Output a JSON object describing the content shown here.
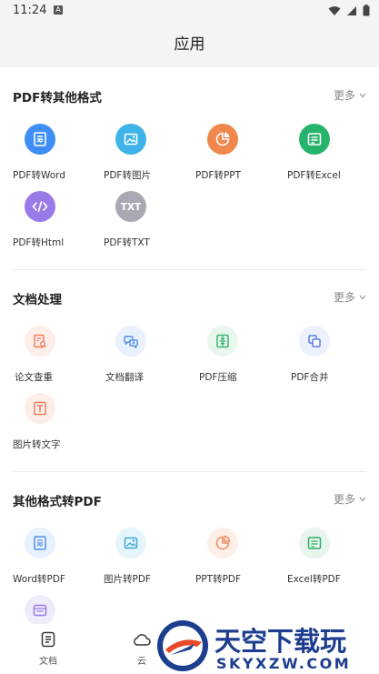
{
  "status": {
    "time": "11:24",
    "badge": "A"
  },
  "header": {
    "title": "应用"
  },
  "sections": [
    {
      "title": "PDF转其他格式",
      "more": "更多",
      "items": [
        {
          "label": "PDF转Word",
          "icon": "document-icon",
          "color": "#3f8ef6"
        },
        {
          "label": "PDF转图片",
          "icon": "image-icon",
          "color": "#3fb2e9"
        },
        {
          "label": "PDF转PPT",
          "icon": "pie-chart-icon",
          "color": "#f0874d"
        },
        {
          "label": "PDF转Excel",
          "icon": "spreadsheet-icon",
          "color": "#26b36c"
        },
        {
          "label": "PDF转Html",
          "icon": "code-icon",
          "color": "#9a7ae8"
        },
        {
          "label": "PDF转TXT",
          "icon": "txt-icon",
          "color": "#a9a9b3"
        }
      ]
    },
    {
      "title": "文档处理",
      "more": "更多",
      "items": [
        {
          "label": "论文查重",
          "icon": "doc-search-icon",
          "color": "#ef8060"
        },
        {
          "label": "文档翻译",
          "icon": "translate-icon",
          "color": "#4f8fe8"
        },
        {
          "label": "PDF压缩",
          "icon": "compress-icon",
          "color": "#36b56f"
        },
        {
          "label": "PDF合并",
          "icon": "merge-icon",
          "color": "#5a7fe0"
        },
        {
          "label": "图片转文字",
          "icon": "ocr-icon",
          "color": "#ef8060"
        }
      ]
    },
    {
      "title": "其他格式转PDF",
      "more": "更多",
      "items": [
        {
          "label": "Word转PDF",
          "icon": "document-icon",
          "color": "#4f8fe8"
        },
        {
          "label": "图片转PDF",
          "icon": "image-icon",
          "color": "#3fa9d9"
        },
        {
          "label": "PPT转PDF",
          "icon": "pie-chart-icon",
          "color": "#ef8a5a"
        },
        {
          "label": "Excel转PDF",
          "icon": "spreadsheet-icon",
          "color": "#2eae6a"
        },
        {
          "label": "",
          "icon": "browser-icon",
          "color": "#9a7ae8"
        }
      ]
    }
  ],
  "tabs": [
    {
      "label": "文档",
      "icon": "document-tab-icon"
    },
    {
      "label": "云",
      "icon": "cloud-icon"
    }
  ],
  "watermark": {
    "text": "天空下载玩",
    "sub": "SKYXZW.COM"
  }
}
